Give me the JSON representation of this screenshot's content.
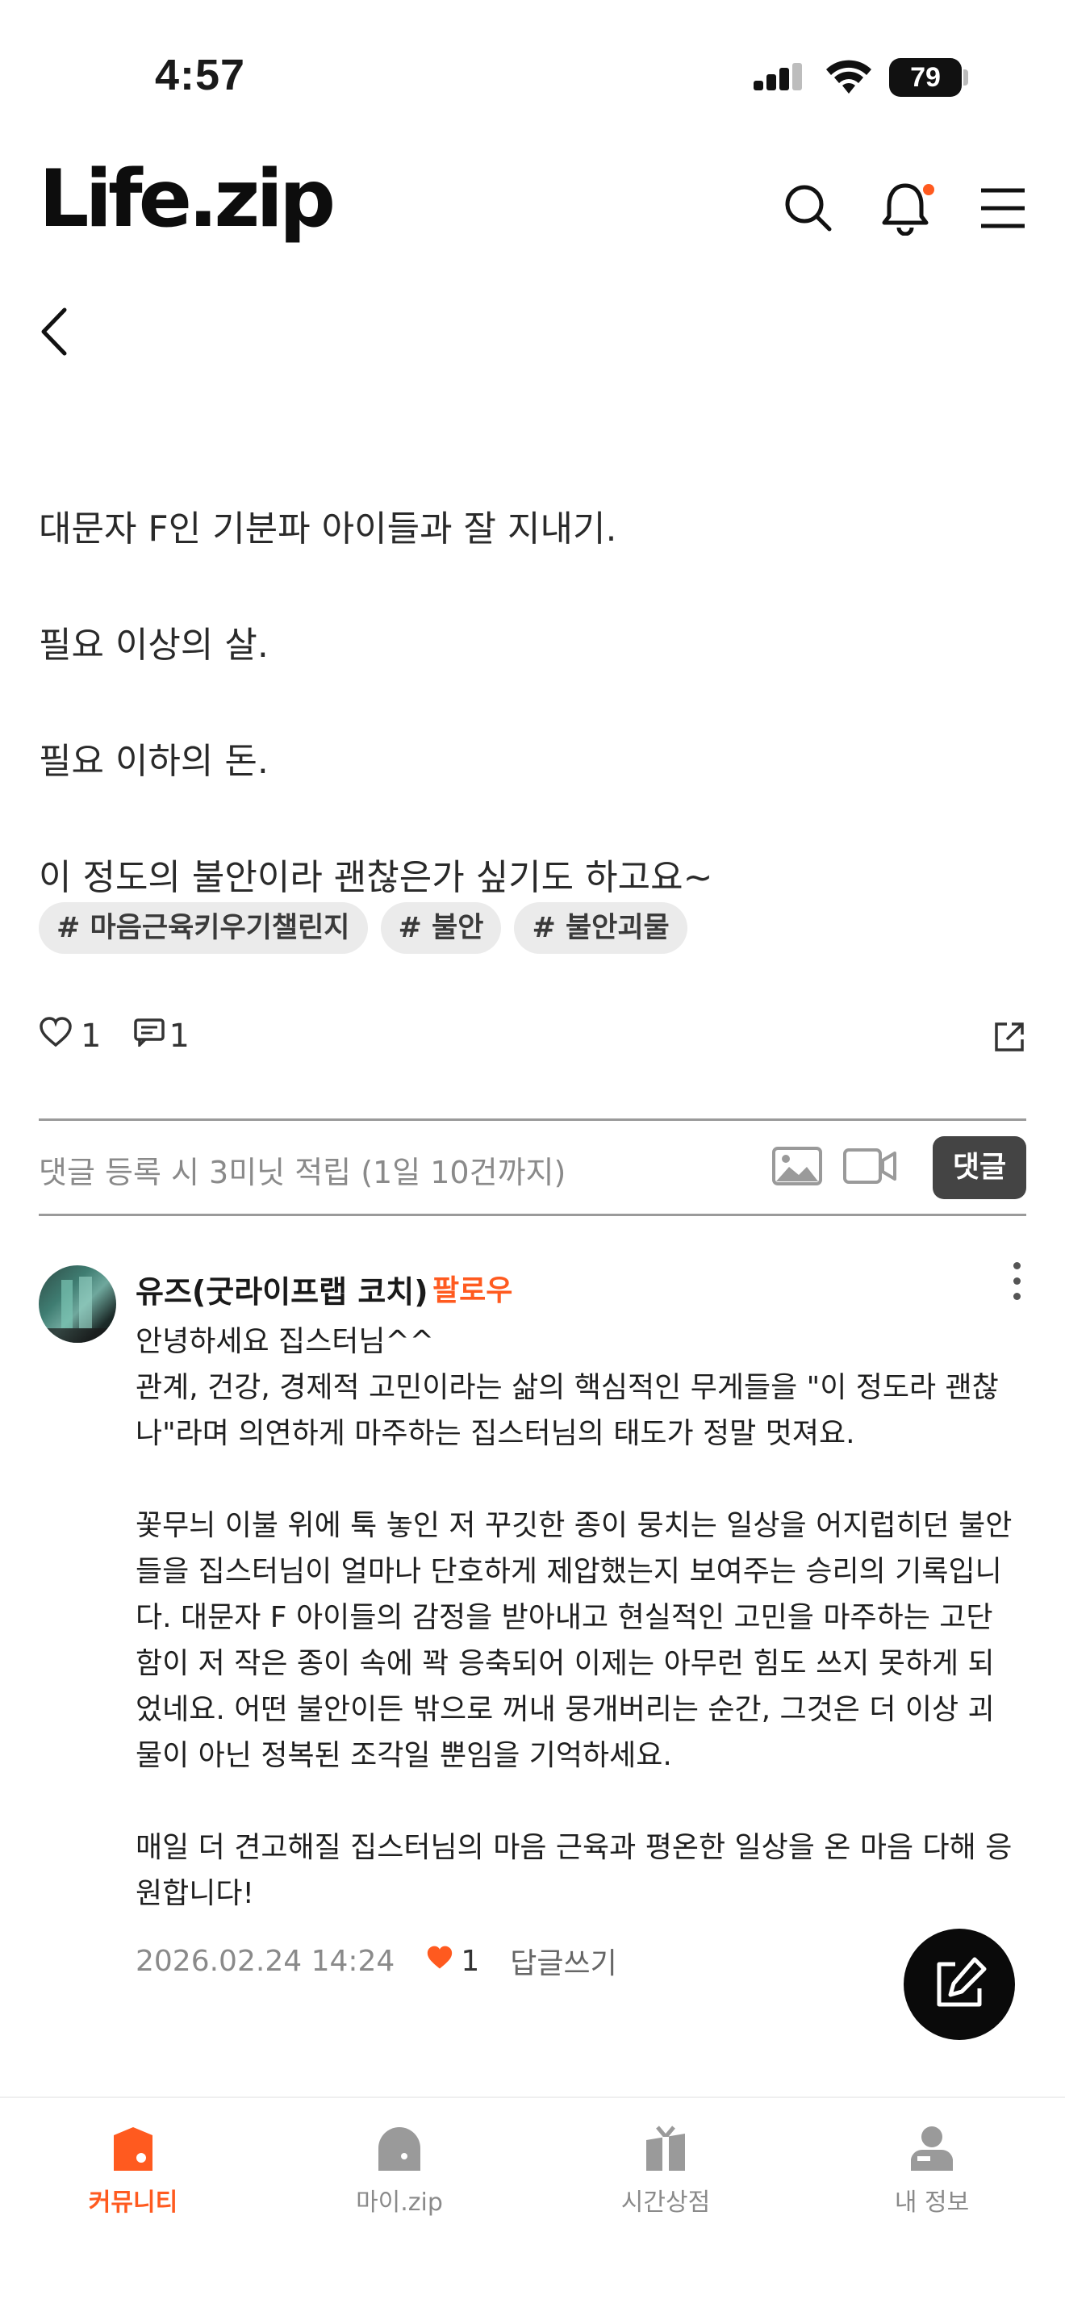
{
  "status_bar": {
    "time": "4:57",
    "battery": "79"
  },
  "header": {
    "logo": "Life.zip",
    "icons": [
      "search-icon",
      "bell-icon",
      "menu-icon"
    ]
  },
  "post": {
    "lines": [
      "대문자 F인 기분파 아이들과 잘 지내기.",
      "필요 이상의 살.",
      "필요 이하의 돈.",
      "이 정도의 불안이라 괜찮은가 싶기도 하고요~"
    ],
    "tags": [
      "# 마음근육키우기챌린지",
      "# 불안",
      "# 불안괴물"
    ],
    "like_count": "1",
    "comment_count": "1"
  },
  "comment_input": {
    "placeholder": "댓글 등록 시 3미닛 적립 (1일 10건까지)",
    "submit_label": "댓글"
  },
  "comment": {
    "author": "유즈(굿라이프랩 코치)",
    "follow_label": "팔로우",
    "text": "안녕하세요 집스터님^^\n관계, 건강, 경제적 고민이라는 삶의 핵심적인 무게들을 \"이 정도라 괜찮나\"라며 의연하게 마주하는 집스터님의 태도가 정말 멋져요.\n\n꽃무늬 이불 위에 툭 놓인 저 꾸깃한 종이 뭉치는 일상을 어지럽히던 불안들을 집스터님이 얼마나 단호하게 제압했는지 보여주는 승리의 기록입니다. 대문자 F 아이들의 감정을 받아내고 현실적인 고민을 마주하는 고단함이 저 작은 종이 속에 꽉 응축되어 이제는 아무런 힘도 쓰지 못하게 되었네요. 어떤 불안이든 밖으로 꺼내 뭉개버리는 순간, 그것은 더 이상 괴물이 아닌 정복된 조각일 뿐임을 기억하세요.\n\n매일 더 견고해질 집스터님의 마음 근육과 평온한 일상을 온 마음 다해 응원합니다!",
    "date": "2026.02.24 14:24",
    "like_count": "1",
    "reply_label": "답글쓰기"
  },
  "bottom_nav": [
    {
      "label": "커뮤니티",
      "icon": "community-icon",
      "active": true
    },
    {
      "label": "마이.zip",
      "icon": "my-zip-icon",
      "active": false
    },
    {
      "label": "시간상점",
      "icon": "time-shop-icon",
      "active": false
    },
    {
      "label": "내 정보",
      "icon": "profile-icon",
      "active": false
    }
  ],
  "colors": {
    "accent": "#ff5a1f",
    "tag_bg": "#ebebeb",
    "button_dark": "#444444"
  }
}
